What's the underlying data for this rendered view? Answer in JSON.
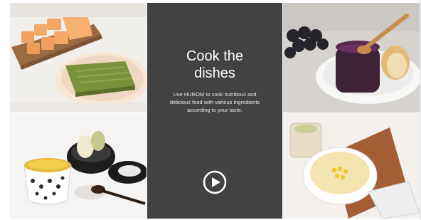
{
  "feature": {
    "title_line1": "Cook the",
    "title_line2": "dishes",
    "description": "Use HUROM to cook nutritious and delicious food with various ingredients according to your taste.",
    "play_icon": "play-circle-icon"
  },
  "tiles": [
    {
      "name": "tofu-and-green-jelly"
    },
    {
      "name": "grape-jam-with-bread"
    },
    {
      "name": "pumpkin-soup-with-bowls"
    },
    {
      "name": "corn-soup-on-board"
    }
  ],
  "colors": {
    "panel": "#424242",
    "text": "#ffffff"
  }
}
